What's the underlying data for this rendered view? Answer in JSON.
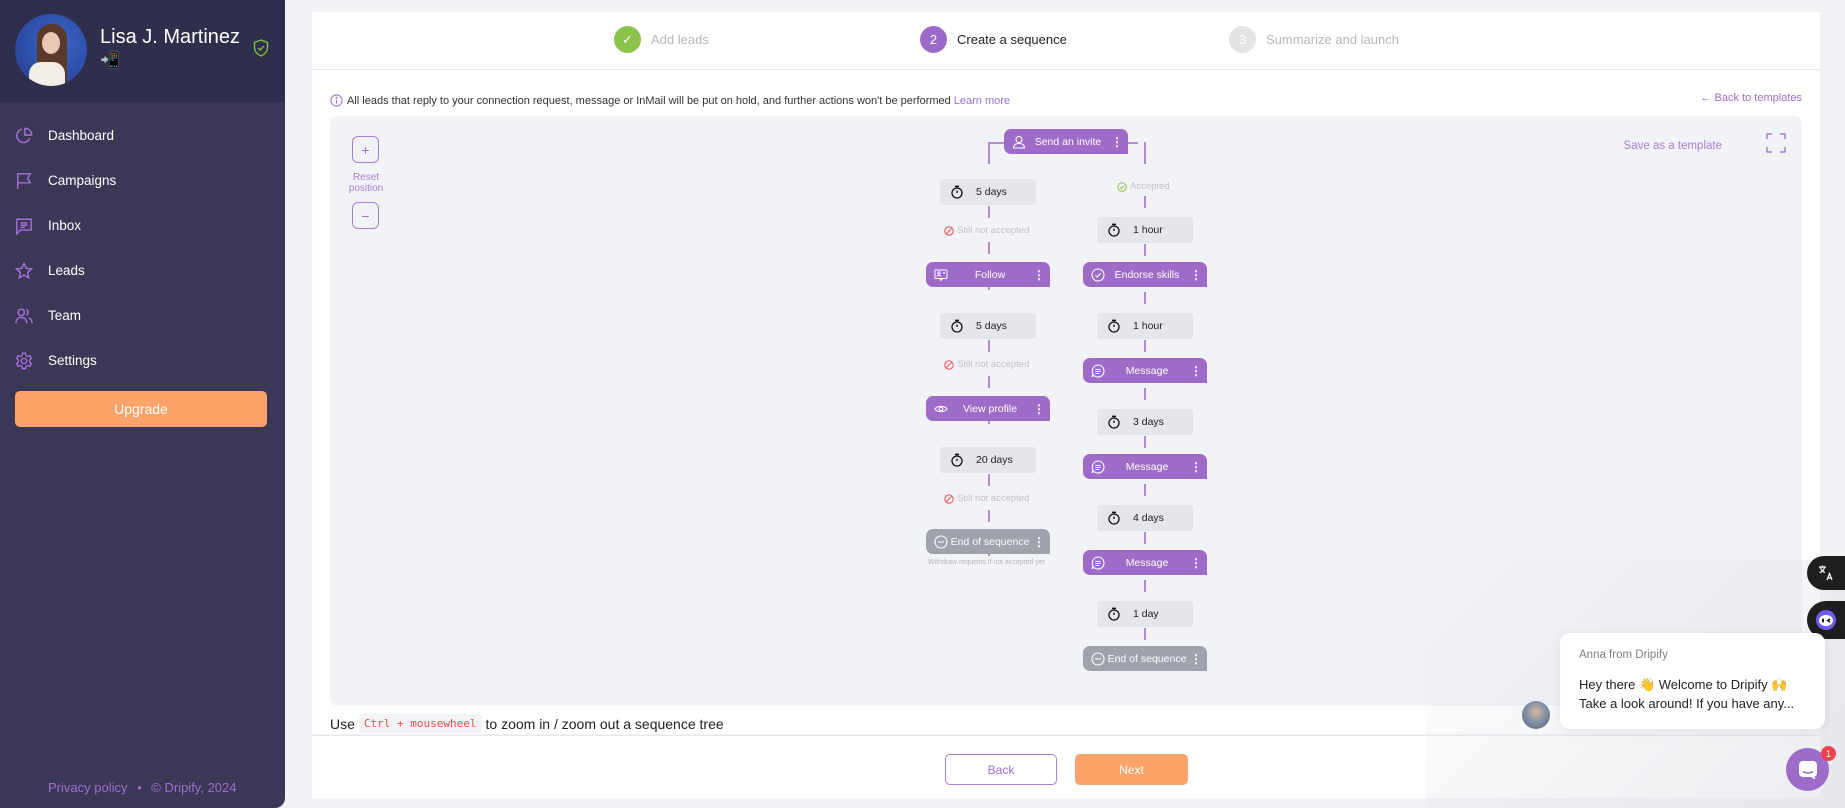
{
  "profile": {
    "name": "Lisa J. Martinez",
    "badge_emoji": "📲",
    "verified_icon": "shield-check-icon"
  },
  "sidebar": {
    "items": [
      {
        "label": "Dashboard",
        "icon": "pie-chart-icon"
      },
      {
        "label": "Campaigns",
        "icon": "flag-icon"
      },
      {
        "label": "Inbox",
        "icon": "message-square-icon"
      },
      {
        "label": "Leads",
        "icon": "star-icon"
      },
      {
        "label": "Team",
        "icon": "users-icon"
      },
      {
        "label": "Settings",
        "icon": "gear-icon"
      }
    ],
    "upgrade_label": "Upgrade",
    "footer": {
      "privacy": "Privacy policy",
      "separator": "•",
      "copyright": "© Dripify, 2024"
    }
  },
  "stepper": {
    "steps": [
      {
        "number": "✓",
        "label": "Add leads",
        "state": "completed"
      },
      {
        "number": "2",
        "label": "Create a sequence",
        "state": "active"
      },
      {
        "number": "3",
        "label": "Summarize and launch",
        "state": "upcoming"
      }
    ]
  },
  "notice": {
    "text": "All leads that reply to your connection request, message or InMail will be put on hold, and further actions won't be performed",
    "link": "Learn more"
  },
  "back_to_templates": "← Back to templates",
  "canvas": {
    "zoom_in": "+",
    "reset_position": "Reset position",
    "zoom_out": "−",
    "save_template": "Save as a template",
    "root": {
      "label": "Send an invite",
      "icon": "user-icon"
    },
    "left_branch": {
      "steps": [
        {
          "type": "delay",
          "label": "5 days"
        },
        {
          "type": "condition",
          "label": "Still not accepted"
        },
        {
          "type": "action",
          "label": "Follow",
          "icon": "follow-icon"
        },
        {
          "type": "delay",
          "label": "5 days"
        },
        {
          "type": "condition",
          "label": "Still not accepted"
        },
        {
          "type": "action",
          "label": "View profile",
          "icon": "eye-icon"
        },
        {
          "type": "delay",
          "label": "20 days"
        },
        {
          "type": "condition",
          "label": "Still not accepted"
        },
        {
          "type": "end",
          "label": "End of sequence",
          "icon": "minus-circle-icon"
        }
      ],
      "end_note": "Withdraw requests if not accepted yet"
    },
    "right_branch": {
      "condition": "Accepted",
      "steps": [
        {
          "type": "delay",
          "label": "1 hour"
        },
        {
          "type": "action",
          "label": "Endorse skills",
          "icon": "check-circle-icon"
        },
        {
          "type": "delay",
          "label": "1 hour"
        },
        {
          "type": "action",
          "label": "Message",
          "icon": "chat-icon"
        },
        {
          "type": "delay",
          "label": "3 days"
        },
        {
          "type": "action",
          "label": "Message",
          "icon": "chat-icon"
        },
        {
          "type": "delay",
          "label": "4 days"
        },
        {
          "type": "action",
          "label": "Message",
          "icon": "chat-icon"
        },
        {
          "type": "delay",
          "label": "1 day"
        },
        {
          "type": "end",
          "label": "End of sequence",
          "icon": "minus-circle-icon"
        }
      ]
    },
    "kebab": "⋮"
  },
  "hint": {
    "before": "Use",
    "code": "Ctrl + mousewheel",
    "after": "to zoom in / zoom out a sequence tree"
  },
  "footer_buttons": {
    "back": "Back",
    "next": "Next"
  },
  "chat": {
    "from": "Anna from Dripify",
    "message_line1": "Hey there 👋 Welcome to Dripify 🙌",
    "message_line2": "Take a look around! If you have any...",
    "unread_count": "1"
  },
  "colors": {
    "sidebar_bg": "#3a3856",
    "accent_purple": "#9e6bc8",
    "accent_orange": "#fba368",
    "success_green": "#8cc34a",
    "end_grey": "#9fa3ab"
  }
}
